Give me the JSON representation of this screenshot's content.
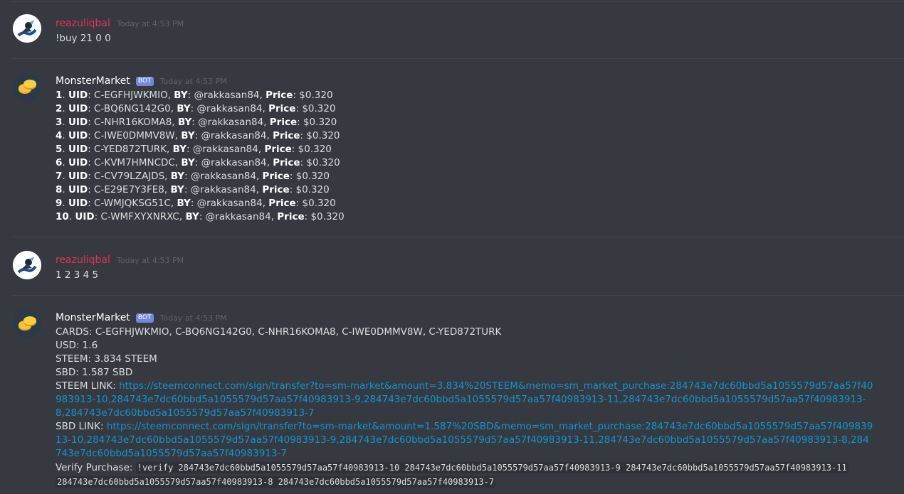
{
  "messages": [
    {
      "username": "reazuliqbal",
      "timestamp": "Today at 4:53 PM",
      "text": "!buy 21 0 0"
    },
    {
      "username": "MonsterMarket",
      "bot_tag": "BOT",
      "timestamp": "Today at 4:53 PM",
      "listings": [
        {
          "n": "1",
          "uid": "C-EGFHJWKMIO",
          "by": "@rakkasan84",
          "price": "$0.320"
        },
        {
          "n": "2",
          "uid": "C-BQ6NG142G0",
          "by": "@rakkasan84",
          "price": "$0.320"
        },
        {
          "n": "3",
          "uid": "C-NHR16KOMA8",
          "by": "@rakkasan84",
          "price": "$0.320"
        },
        {
          "n": "4",
          "uid": "C-IWE0DMMV8W",
          "by": "@rakkasan84",
          "price": "$0.320"
        },
        {
          "n": "5",
          "uid": "C-YED872TURK",
          "by": "@rakkasan84",
          "price": "$0.320"
        },
        {
          "n": "6",
          "uid": "C-KVM7HMNCDC",
          "by": "@rakkasan84",
          "price": "$0.320"
        },
        {
          "n": "7",
          "uid": "C-CV79LZAJDS",
          "by": "@rakkasan84",
          "price": "$0.320"
        },
        {
          "n": "8",
          "uid": "C-E29E7Y3FE8",
          "by": "@rakkasan84",
          "price": "$0.320"
        },
        {
          "n": "9",
          "uid": "C-WMJQKSG51C",
          "by": "@rakkasan84",
          "price": "$0.320"
        },
        {
          "n": "10",
          "uid": "C-WMFXYXNRXC",
          "by": "@rakkasan84",
          "price": "$0.320"
        }
      ],
      "labels": {
        "uid": "UID",
        "by": "BY",
        "price": "Price"
      }
    },
    {
      "username": "reazuliqbal",
      "timestamp": "Today at 4:53 PM",
      "text": "1 2 3 4 5"
    },
    {
      "username": "MonsterMarket",
      "bot_tag": "BOT",
      "timestamp": "Today at 4:53 PM",
      "cards_line": "CARDS: C-EGFHJWKMIO, C-BQ6NG142G0, C-NHR16KOMA8, C-IWE0DMMV8W, C-YED872TURK",
      "usd_line": "USD: 1.6",
      "steem_line": "STEEM: 3.834 STEEM",
      "sbd_line": "SBD: 1.587 SBD",
      "steem_link_label": "STEEM LINK: ",
      "steem_link": "https://steemconnect.com/sign/transfer?to=sm-market&amount=3.834%20STEEM&memo=sm_market_purchase:284743e7dc60bbd5a1055579d57aa57f40983913-10,284743e7dc60bbd5a1055579d57aa57f40983913-9,284743e7dc60bbd5a1055579d57aa57f40983913-11,284743e7dc60bbd5a1055579d57aa57f40983913-8,284743e7dc60bbd5a1055579d57aa57f40983913-7",
      "sbd_link_label": "SBD LINK: ",
      "sbd_link": "https://steemconnect.com/sign/transfer?to=sm-market&amount=1.587%20SBD&memo=sm_market_purchase:284743e7dc60bbd5a1055579d57aa57f40983913-10,284743e7dc60bbd5a1055579d57aa57f40983913-9,284743e7dc60bbd5a1055579d57aa57f40983913-11,284743e7dc60bbd5a1055579d57aa57f40983913-8,284743e7dc60bbd5a1055579d57aa57f40983913-7",
      "verify_label": "Verify Purchase: ",
      "verify_code_1": "!verify 284743e7dc60bbd5a1055579d57aa57f40983913-10 284743e7dc60bbd5a1055579d57aa57f40983913-9 284743e7dc60bbd5a1055579d57aa57f40983913-11",
      "verify_code_2": "284743e7dc60bbd5a1055579d57aa57f40983913-8 284743e7dc60bbd5a1055579d57aa57f40983913-7"
    }
  ],
  "colors": {
    "background": "#36393f",
    "user_name": "#e7305a",
    "bot_name": "#ffffff",
    "link": "#0b97d4",
    "bot_tag": "#7289da"
  }
}
